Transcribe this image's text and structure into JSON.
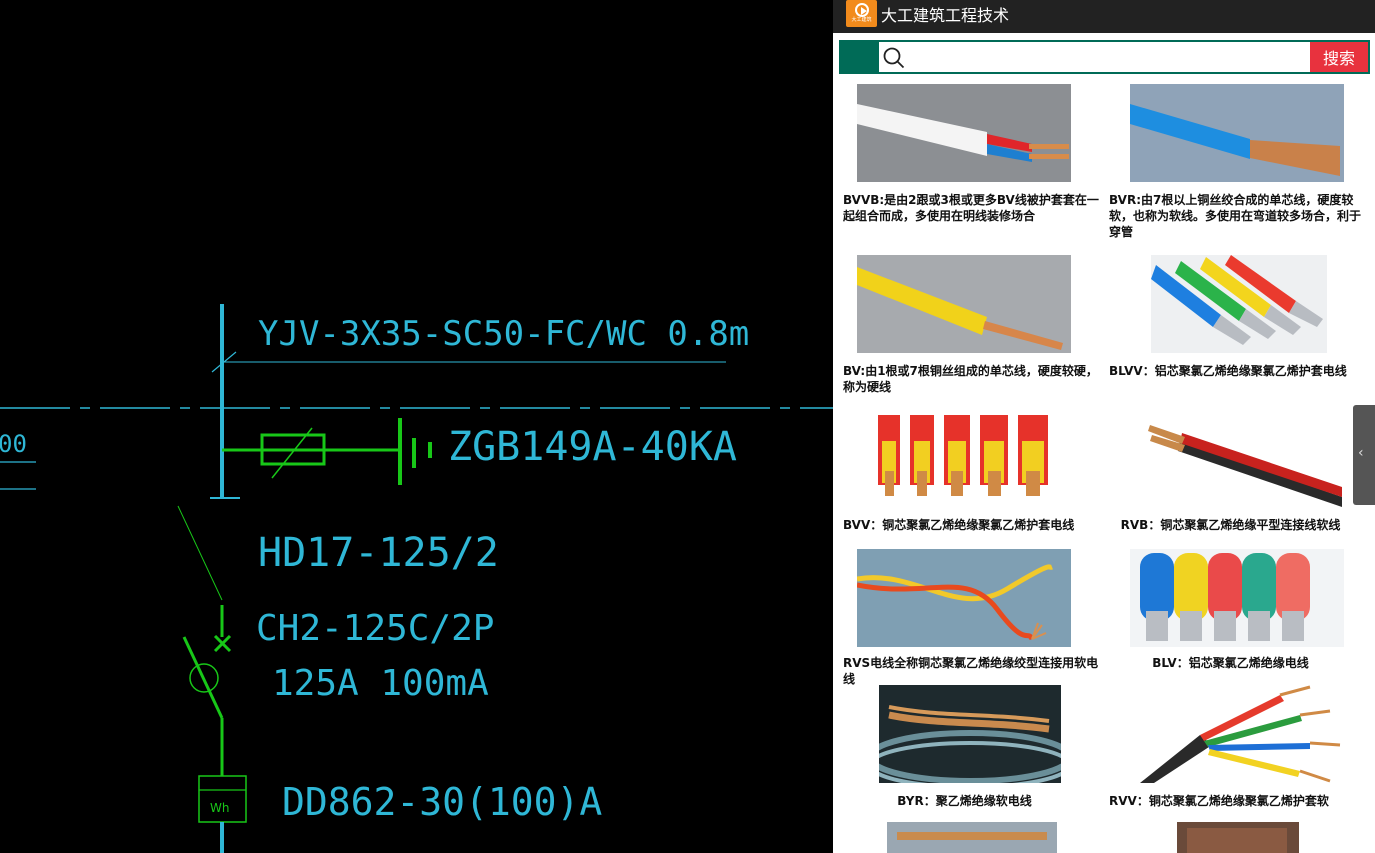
{
  "cad": {
    "labels": {
      "cable": "YJV-3X35-SC50-FC/WC 0.8m",
      "surge": "ZGB149A-40KA",
      "switch": "HD17-125/2",
      "breaker": "CH2-125C/2P",
      "rating": "125A  100mA",
      "meter": "DD862-30(100)A",
      "meter_symbol": "Wh",
      "left_fragment": "00"
    }
  },
  "app": {
    "title": "大工建筑工程技术",
    "logo_text": "大工建筑",
    "search": {
      "placeholder": "",
      "button_label": "搜索"
    },
    "items": [
      {
        "caption": "BVVB:是由2跟或3根或更多BV线被护套套在一起组合而成，多使用在明线装修场合",
        "image": "white-red-blue-wire"
      },
      {
        "caption": "BVR:由7根以上铜丝绞合成的单芯线，硬度较软，也称为软线。多使用在弯道较多场合，利于穿管",
        "image": "blue-stranded-wire"
      },
      {
        "caption": "BV:由1根或7根铜丝组成的单芯线，硬度较硬，称为硬线",
        "image": "yellow-solid-wire"
      },
      {
        "caption": "BLVV：铝芯聚氯乙烯绝缘聚氯乙烯护套电线",
        "image": "colored-aluminum-wires"
      },
      {
        "caption": "BVV：铜芯聚氯乙烯绝缘聚氯乙烯护套电线",
        "image": "red-yellow-copper-wires"
      },
      {
        "caption": "RVB：铜芯聚氯乙烯绝缘平型连接线软线",
        "image": "red-black-flat-wire"
      },
      {
        "caption": "RVS电线全称铜芯聚氯乙烯绝缘绞型连接用软电线",
        "image": "twisted-pair-wire"
      },
      {
        "caption": "BLV：铝芯聚氯乙烯绝缘电线",
        "image": "colored-aluminum-cable"
      },
      {
        "caption": "BYR：聚乙烯绝缘软电线",
        "image": "copper-coil-wire"
      },
      {
        "caption": "RVV：铜芯聚氯乙烯绝缘聚氯乙烯护套软",
        "image": "multicore-sheathed-cable"
      }
    ],
    "side_tab_icon": "chevron-left-icon"
  }
}
